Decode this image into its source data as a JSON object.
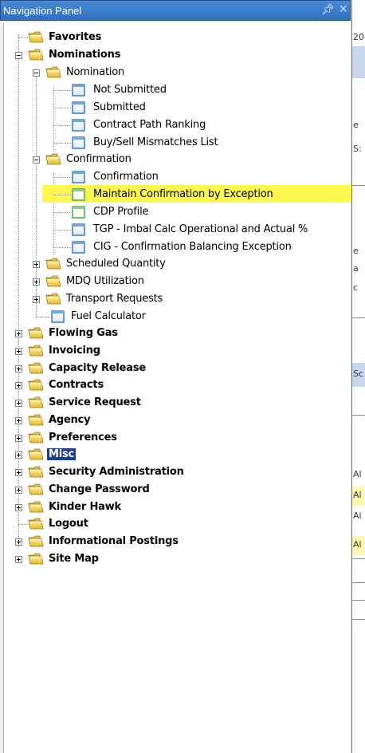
{
  "panel": {
    "title": "Navigation Panel",
    "pin_icon": "pin-icon",
    "close_icon": "close-icon"
  },
  "colors": {
    "title_bar": "#2f6fbc",
    "highlight": "#fff64f",
    "selected_bg": "#1c3e8e"
  },
  "tree": {
    "favorites": "Favorites",
    "nominations": "Nominations",
    "nomination": "Nomination",
    "not_submitted": "Not Submitted",
    "submitted": "Submitted",
    "contract_path_ranking": "Contract Path Ranking",
    "buy_sell_mismatches": "Buy/Sell Mismatches List",
    "confirmation_folder": "Confirmation",
    "confirmation_page": "Confirmation",
    "maintain_confirmation": "Maintain Confirmation by Exception",
    "cdp_profile": "CDP Profile",
    "tgp_imbal": "TGP - Imbal Calc Operational and Actual %",
    "cig_confirmation": "CIG - Confirmation Balancing Exception",
    "scheduled_quantity": "Scheduled Quantity",
    "mdq_utilization": "MDQ Utilization",
    "transport_requests": "Transport Requests",
    "fuel_calculator": "Fuel Calculator",
    "flowing_gas": "Flowing Gas",
    "invoicing": "Invoicing",
    "capacity_release": "Capacity Release",
    "contracts": "Contracts",
    "service_request": "Service Request",
    "agency": "Agency",
    "preferences": "Preferences",
    "misc": "Misc",
    "security_administration": "Security Administration",
    "change_password": "Change Password",
    "kinder_hawk": "Kinder Hawk",
    "logout": "Logout",
    "informational_postings": "Informational Postings",
    "site_map": "Site Map"
  },
  "right_pane": {
    "fragments": [
      "20",
      "e",
      "S:",
      "e",
      "a",
      "c",
      "Sc",
      "Al",
      "Al",
      "Al",
      "Al"
    ]
  }
}
